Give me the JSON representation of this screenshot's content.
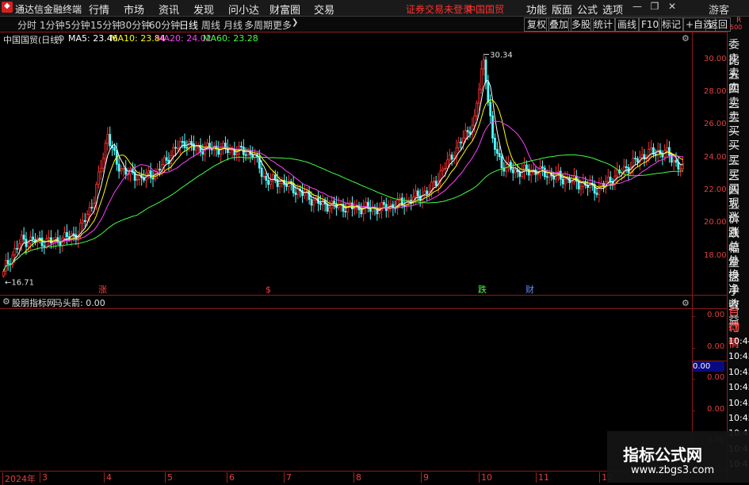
{
  "window": {
    "app_name": "通达信金融终端"
  },
  "menu": [
    "行情",
    "市场",
    "资讯",
    "发现",
    "问小达",
    "财富圈",
    "交易"
  ],
  "notice": {
    "trade_login": "证券交易未登录",
    "stock": "中国国贸"
  },
  "right_menu": [
    "功能",
    "版面",
    "公式",
    "选项"
  ],
  "guest": "游客",
  "periods": [
    "分时",
    "1分钟",
    "5分钟",
    "15分钟",
    "30分钟",
    "60分钟",
    "日线",
    "周线",
    "月线",
    "多周期",
    "更多"
  ],
  "active_period": "日线",
  "right_tools": [
    "复权",
    "叠加",
    "多股",
    "统计",
    "画线",
    "F10",
    "标记",
    "+自选",
    "返回"
  ],
  "main_chart": {
    "title": "中国国贸(日线)",
    "ma": [
      {
        "label": "MA5: 23.46",
        "color": "#ffffff"
      },
      {
        "label": "MA10: 23.84",
        "color": "#ffff00"
      },
      {
        "label": "MA20: 24.02",
        "color": "#ff40ff"
      },
      {
        "label": "MA60: 23.28",
        "color": "#40ff40"
      }
    ],
    "max_label": "30.34",
    "min_label": "16.71",
    "event_marks": [
      {
        "text": "涨",
        "color": "#ff4040"
      },
      {
        "text": "$",
        "color": "#ff4040"
      },
      {
        "text": "跌",
        "color": "#40ff40"
      },
      {
        "text": "财",
        "color": "#6090ff"
      }
    ]
  },
  "sub_chart": {
    "title": "股朋指标网",
    "indicator": "马头箭: 0.00",
    "y_ticks": [
      "0.00",
      "0.00",
      "0.00",
      "0.00",
      "0.00"
    ],
    "cur_value": "0.00"
  },
  "right_panel": {
    "corner": [
      "R",
      "500"
    ],
    "labels": [
      "委比",
      "卖五",
      "卖四",
      "卖三",
      "卖二",
      "卖一",
      "买一",
      "买二",
      "买三",
      "买四",
      "买五",
      "现价",
      "涨跌",
      "涨幅",
      "总量",
      "外盘",
      "换手",
      "净资",
      "收益",
      "自动",
      "行情"
    ],
    "times": [
      "10:44",
      "10:45",
      "10:45",
      "10:45",
      "10:45",
      "10:45",
      "10:45",
      "10:45",
      "10:45"
    ]
  },
  "x_axis": [
    "2024年",
    "3",
    "4",
    "5",
    "6",
    "7",
    "8",
    "9",
    "10",
    "11",
    "12"
  ],
  "watermark": {
    "title": "指标公式网",
    "url": "www.zbgs3.com"
  },
  "chart_data": {
    "type": "candlestick",
    "title": "中国国贸(日线)",
    "ylim": [
      16.0,
      31.0
    ],
    "y_ticks": [
      18.0,
      20.0,
      22.0,
      24.0,
      26.0,
      28.0,
      30.0
    ],
    "anchors": [
      [
        0,
        17.2
      ],
      [
        8,
        19.0
      ],
      [
        22,
        18.9
      ],
      [
        33,
        19.4
      ],
      [
        40,
        21.5
      ],
      [
        46,
        25.5
      ],
      [
        50,
        23.6
      ],
      [
        56,
        23.0
      ],
      [
        62,
        22.8
      ],
      [
        68,
        23.2
      ],
      [
        76,
        24.6
      ],
      [
        80,
        25.0
      ],
      [
        84,
        24.6
      ],
      [
        95,
        24.6
      ],
      [
        110,
        24.3
      ],
      [
        116,
        22.6
      ],
      [
        122,
        22.6
      ],
      [
        130,
        22.0
      ],
      [
        140,
        21.2
      ],
      [
        152,
        21.0
      ],
      [
        166,
        20.9
      ],
      [
        177,
        21.3
      ],
      [
        188,
        22.0
      ],
      [
        202,
        25.0
      ],
      [
        208,
        26.3
      ],
      [
        212,
        30.3
      ],
      [
        216,
        25.0
      ],
      [
        220,
        23.6
      ],
      [
        226,
        23.2
      ],
      [
        236,
        23.2
      ],
      [
        246,
        22.8
      ],
      [
        256,
        22.4
      ],
      [
        262,
        22.1
      ],
      [
        268,
        22.7
      ],
      [
        276,
        23.5
      ],
      [
        284,
        24.3
      ],
      [
        292,
        24.4
      ],
      [
        300,
        23.3
      ]
    ],
    "ma_colors": {
      "MA5": "#ffffff",
      "MA10": "#ffff00",
      "MA20": "#ff40ff",
      "MA60": "#40ff40"
    }
  }
}
